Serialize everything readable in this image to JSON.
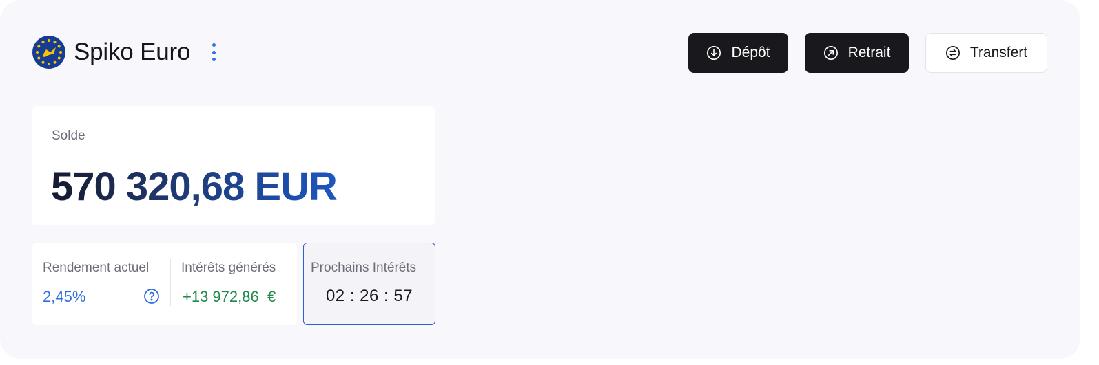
{
  "header": {
    "title": "Spiko Euro",
    "logo_icon": "eu-flag-logo",
    "menu_icon": "kebab-menu-icon"
  },
  "actions": {
    "depot": {
      "label": "Dépôt",
      "icon": "arrow-down-circle-icon"
    },
    "retrait": {
      "label": "Retrait",
      "icon": "arrow-up-right-circle-icon"
    },
    "transfert": {
      "label": "Transfert",
      "icon": "transfer-circle-icon"
    }
  },
  "balance": {
    "label": "Solde",
    "value": "570 320,68 EUR"
  },
  "stats": {
    "rendement": {
      "label": "Rendement actuel",
      "value": "2,45%",
      "help_icon": "question-circle-icon"
    },
    "interets": {
      "label": "Intérêts générés",
      "value": "+13 972,86  €"
    },
    "prochains": {
      "label": "Prochains Intérêts",
      "value": "02 : 26 : 57"
    }
  },
  "colors": {
    "accent_blue": "#2f6fe0",
    "positive_green": "#1f8a4c",
    "dark_button": "#19181d",
    "panel_bg": "#f8f7fb"
  }
}
